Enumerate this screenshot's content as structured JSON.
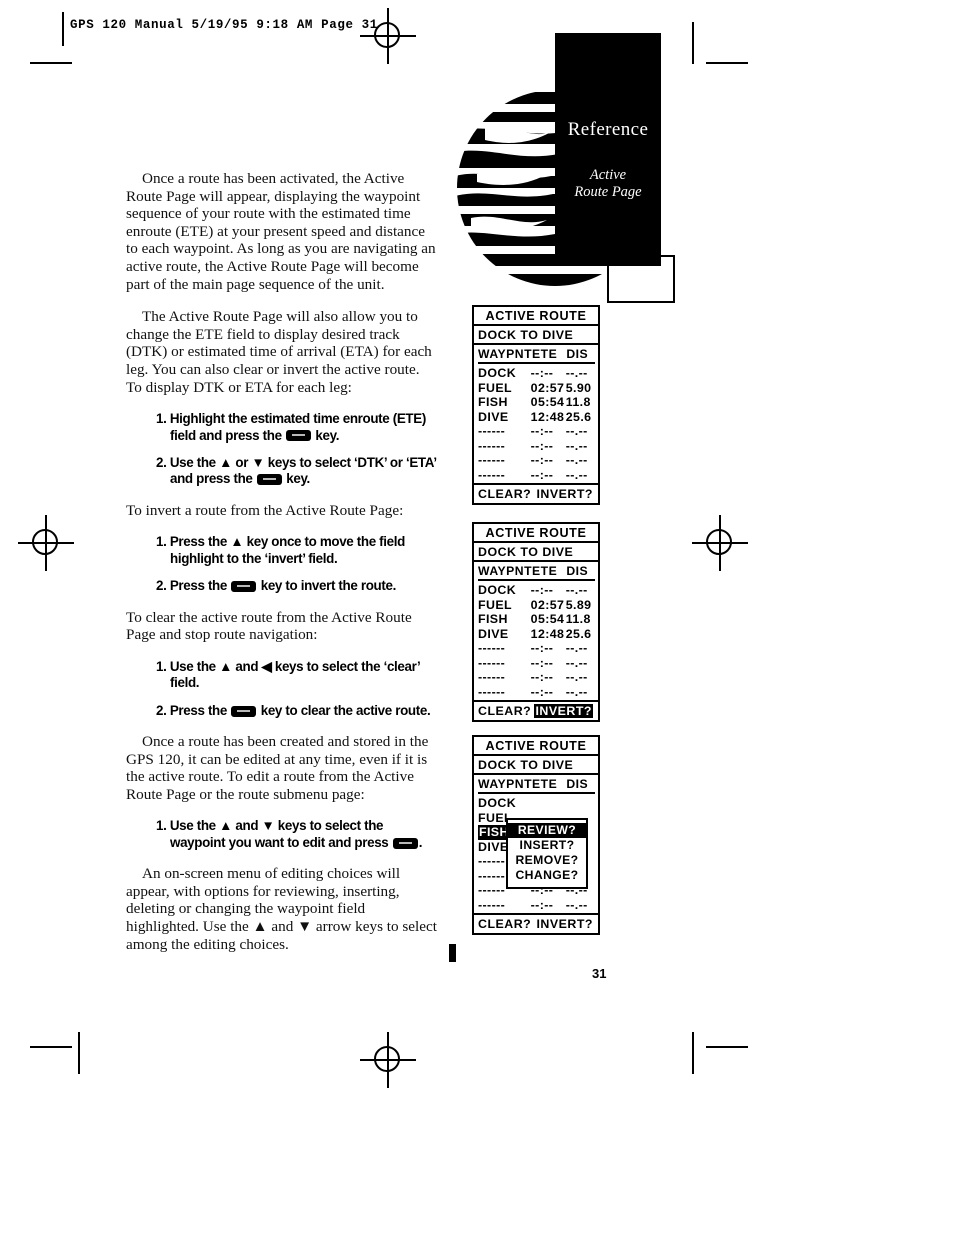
{
  "slug": {
    "text": "GPS 120 Manual  5/19/95 9:18 AM  Page 31"
  },
  "page_number": "31",
  "tab": {
    "title": "Reference",
    "subtitle_line1": "Active",
    "subtitle_line2": "Route Page"
  },
  "body": {
    "p1": "Once a route has been activated, the Active Route Page will appear, displaying the waypoint sequence of your route with the estimated time enroute (ETE) at your present speed and distance to each waypoint. As long as you are navigating an active route, the Active Route Page will become part of the main page sequence of the unit.",
    "p2": "The Active Route Page will also allow you to change the ETE field to display desired track (DTK) or estimated time of arrival (ETA) for each leg. You can also clear or invert the active route. To display DTK or ETA for each leg:",
    "p3": "To invert a route from the Active Route Page:",
    "p4": "To clear the active route from the Active Route Page and stop route navigation:",
    "p5": "Once a route has been created and stored in the GPS 120, it can be edited at any time, even if it is the active route. To edit a route from the Active Route Page or the route submenu page:",
    "p6": "An on-screen menu of editing choices will appear, with options for reviewing, inserting, deleting or changing the waypoint field highlighted. Use the ▲ and ▼ arrow keys to select among the editing choices."
  },
  "steps_group1": [
    {
      "num": "1.",
      "pre": "Highlight the estimated time enroute (ETE) field and press the ",
      "post": " key."
    },
    {
      "num": "2.",
      "pre": "Use the ▲ or ▼ keys to select ‘DTK’ or ‘ETA’ and press the ",
      "post": " key."
    }
  ],
  "steps_group2": [
    {
      "num": "1.",
      "pre": "Press the ▲ key once to move the field highlight to the ‘invert’ field.",
      "post": ""
    },
    {
      "num": "2.",
      "pre": "Press the ",
      "post": " key to invert the route."
    }
  ],
  "steps_group3": [
    {
      "num": "1.",
      "pre": "Use the ▲ and ◀ keys to select the ‘clear’ field.",
      "post": ""
    },
    {
      "num": "2.",
      "pre": "Press the ",
      "post": " key to clear the active route."
    }
  ],
  "steps_group4": [
    {
      "num": "1.",
      "pre": "Use the ▲ and ▼ keys to select the waypoint you want to edit and press ",
      "post": "."
    }
  ],
  "lcd_common": {
    "title": "ACTIVE ROUTE",
    "route": "DOCK TO DIVE",
    "col_waypoint": "WAYPNT",
    "col_ete": "ETE",
    "col_dis": "DIS",
    "clear_label": "CLEAR?",
    "invert_label": "INVERT?",
    "empty_row": {
      "wpt": "------",
      "ete": "--:--",
      "dis": "--.--"
    }
  },
  "lcd_screens": [
    {
      "name": "active-route-page",
      "rows": [
        {
          "wpt": "DOCK",
          "ete": "--:--",
          "dis": "--.--"
        },
        {
          "wpt": "FUEL",
          "ete": "02:57",
          "dis": "5.90"
        },
        {
          "wpt": "FISH",
          "ete": "05:54",
          "dis": "11.8"
        },
        {
          "wpt": "DIVE",
          "ete": "12:48",
          "dis": "25.6"
        }
      ],
      "empty_rows": 4,
      "highlight": "none",
      "popup": null
    },
    {
      "name": "active-route-invert-selected",
      "rows": [
        {
          "wpt": "DOCK",
          "ete": "--:--",
          "dis": "--.--"
        },
        {
          "wpt": "FUEL",
          "ete": "02:57",
          "dis": "5.89"
        },
        {
          "wpt": "FISH",
          "ete": "05:54",
          "dis": "11.8"
        },
        {
          "wpt": "DIVE",
          "ete": "12:48",
          "dis": "25.6"
        }
      ],
      "empty_rows": 4,
      "highlight": "invert",
      "popup": null
    },
    {
      "name": "active-route-edit-submenu",
      "rows": [
        {
          "wpt": "DOCK",
          "ete": "",
          "dis": ""
        },
        {
          "wpt": "FUEL",
          "ete": "",
          "dis": ""
        },
        {
          "wpt": "FISH",
          "ete": "",
          "dis": ""
        },
        {
          "wpt": "DIVE",
          "ete": "",
          "dis": ""
        }
      ],
      "empty_rows": 4,
      "highlight": "waypoint-fish",
      "popup": {
        "items": [
          "REVIEW?",
          "INSERT?",
          "REMOVE?",
          "CHANGE?"
        ],
        "selected_index": 0
      }
    }
  ]
}
